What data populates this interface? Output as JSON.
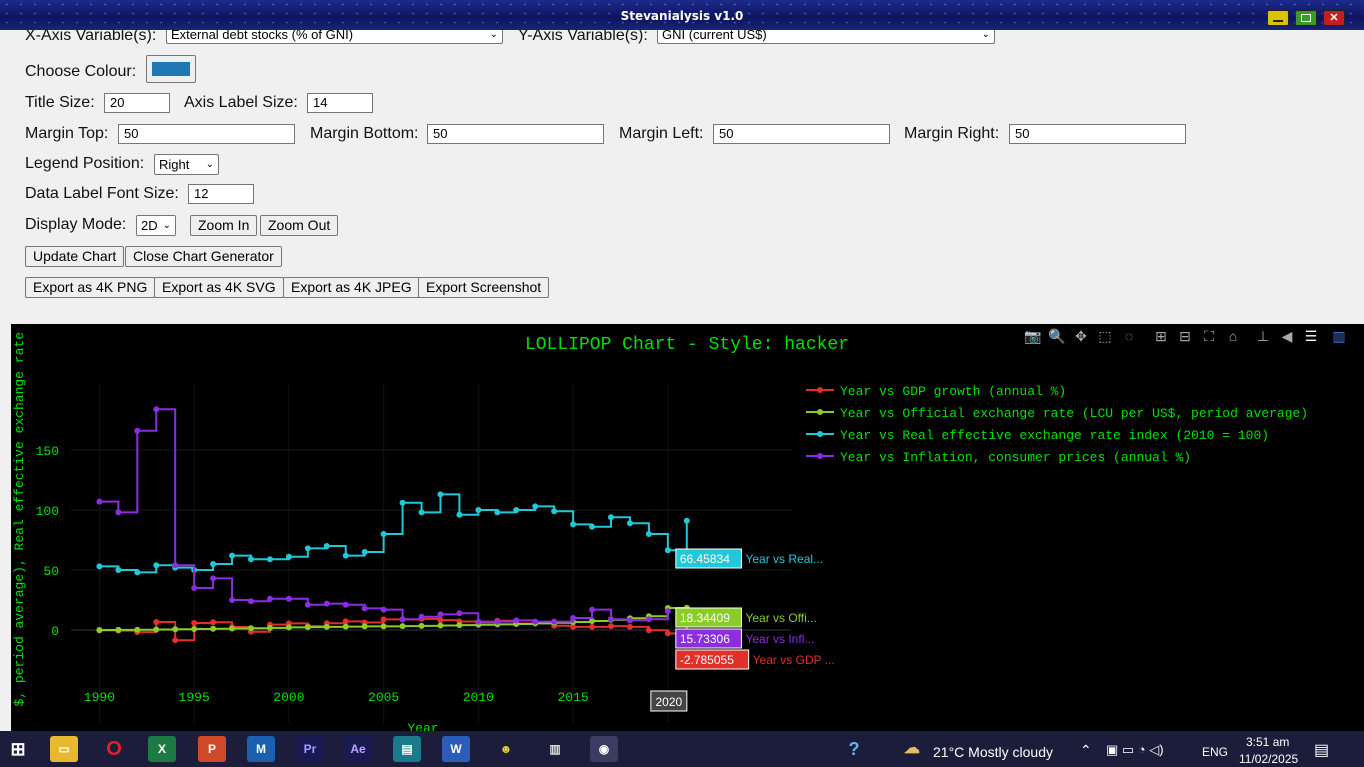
{
  "window": {
    "title": "Stevanialysis v1.0"
  },
  "form": {
    "x_axis_label": "X-Axis Variable(s):",
    "x_axis_value": "External debt stocks (% of GNI)",
    "y_axis_label": "Y-Axis Variable(s):",
    "y_axis_value": "GNI (current US$)",
    "colour_label": "Choose Colour:",
    "colour_value": "#1f77b4",
    "title_size_label": "Title Size:",
    "title_size_value": "20",
    "axis_label_size_label": "Axis Label Size:",
    "axis_label_size_value": "14",
    "margin_top_label": "Margin Top:",
    "margin_top_value": "50",
    "margin_bottom_label": "Margin Bottom:",
    "margin_bottom_value": "50",
    "margin_left_label": "Margin Left:",
    "margin_left_value": "50",
    "margin_right_label": "Margin Right:",
    "margin_right_value": "50",
    "legend_position_label": "Legend Position:",
    "legend_position_value": "Right",
    "data_label_font_label": "Data Label Font Size:",
    "data_label_font_value": "12",
    "display_mode_label": "Display Mode:",
    "display_mode_value": "2D",
    "zoom_in": "Zoom In",
    "zoom_out": "Zoom Out",
    "update_chart": "Update Chart",
    "close_generator": "Close Chart Generator",
    "export_png": "Export as 4K PNG",
    "export_svg": "Export as 4K SVG",
    "export_jpeg": "Export as 4K JPEG",
    "export_screenshot": "Export Screenshot"
  },
  "chart_data": {
    "type": "line",
    "line_shape": "step",
    "title": "LOLLIPOP Chart - Style: hacker",
    "xlabel": "Year",
    "ylabel": "$, period average), Real effective exchange rate",
    "xlim": [
      1988.5,
      2026.5
    ],
    "ylim": [
      -45,
      205
    ],
    "x_ticks": [
      1990,
      1995,
      2000,
      2005,
      2010,
      2015,
      2020
    ],
    "y_ticks": [
      0,
      50,
      100,
      150
    ],
    "grid": true,
    "legend_position": "top-right",
    "background": "#000000",
    "text_color": "#00e000",
    "series": [
      {
        "name": "Year vs GDP growth (annual %)",
        "color": "#e0302a",
        "x": [
          1990,
          1991,
          1992,
          1993,
          1994,
          1995,
          1996,
          1997,
          1998,
          1999,
          2000,
          2001,
          2002,
          2003,
          2004,
          2005,
          2006,
          2007,
          2008,
          2009,
          2010,
          2011,
          2012,
          2013,
          2014,
          2015,
          2016,
          2017,
          2018,
          2019,
          2020,
          2021
        ],
        "y": [
          -0.3,
          -0.5,
          -1.8,
          6.7,
          -8.5,
          5.8,
          6.5,
          2.5,
          -1.5,
          4.5,
          5.5,
          3.2,
          5.6,
          7.2,
          6.2,
          8.9,
          8.7,
          9.3,
          8.2,
          7.1,
          6.4,
          7.7,
          5.4,
          5.5,
          3.5,
          2.6,
          2.6,
          3.2,
          2.6,
          -0.2,
          -2.785055,
          5.2
        ],
        "hover_label": "-2.785055",
        "hover_name": "Year vs GDP ..."
      },
      {
        "name": "Year vs Official exchange rate (LCU per US$, period average)",
        "color": "#8acc2a",
        "x": [
          1990,
          1991,
          1992,
          1993,
          1994,
          1995,
          1996,
          1997,
          1998,
          1999,
          2000,
          2001,
          2002,
          2003,
          2004,
          2005,
          2006,
          2007,
          2008,
          2009,
          2010,
          2011,
          2012,
          2013,
          2014,
          2015,
          2016,
          2017,
          2018,
          2019,
          2020,
          2021
        ],
        "y": [
          0,
          0.1,
          0.2,
          0.4,
          0.6,
          0.8,
          1.0,
          1.2,
          1.5,
          1.8,
          2.2,
          2.4,
          2.6,
          2.8,
          3.0,
          3.0,
          3.2,
          3.4,
          3.7,
          4.1,
          4.4,
          4.7,
          5.0,
          5.5,
          6.0,
          6.7,
          7.5,
          8.5,
          9.8,
          11.5,
          18.34409,
          18.5
        ],
        "hover_label": "18.34409",
        "hover_name": "Year vs Offi..."
      },
      {
        "name": "Year vs Real effective exchange rate index (2010 = 100)",
        "color": "#22c8d8",
        "x": [
          1990,
          1991,
          1992,
          1993,
          1994,
          1995,
          1996,
          1997,
          1998,
          1999,
          2000,
          2001,
          2002,
          2003,
          2004,
          2005,
          2006,
          2007,
          2008,
          2009,
          2010,
          2011,
          2012,
          2013,
          2014,
          2015,
          2016,
          2017,
          2018,
          2019,
          2020,
          2021
        ],
        "y": [
          53,
          50,
          48,
          54,
          52,
          50,
          55,
          62,
          59,
          59,
          61,
          68,
          70,
          62,
          65,
          80,
          106,
          98,
          113,
          96,
          100,
          98,
          100,
          103,
          99,
          88,
          86,
          94,
          89,
          80,
          66.45834,
          91
        ],
        "hover_label": "66.45834",
        "hover_name": "Year vs Real..."
      },
      {
        "name": "Year vs Inflation, consumer prices (annual %)",
        "color": "#8a2ee0",
        "x": [
          1990,
          1991,
          1992,
          1993,
          1994,
          1995,
          1996,
          1997,
          1998,
          1999,
          2000,
          2001,
          2002,
          2003,
          2004,
          2005,
          2006,
          2007,
          2008,
          2009,
          2010,
          2011,
          2012,
          2013,
          2014,
          2015,
          2016,
          2017,
          2018,
          2019,
          2020
        ],
        "y": [
          107,
          98,
          166,
          184,
          54,
          35,
          43,
          25,
          24,
          26,
          26,
          21,
          22,
          21,
          18,
          17,
          9,
          11,
          13,
          14,
          7,
          7,
          8,
          7,
          7,
          10,
          17,
          9,
          8,
          9,
          15.73306
        ],
        "hover_label": "15.73306",
        "hover_name": "Year vs Infl..."
      }
    ],
    "hover_x_label": "2020"
  },
  "modebar_icons": [
    "camera-icon",
    "zoom-icon",
    "pan-icon",
    "box-select-icon",
    "lasso-icon",
    "zoom-in-icon",
    "zoom-out-icon",
    "autoscale-icon",
    "home-icon",
    "spike-icon",
    "hover-closest-icon",
    "hover-compare-icon",
    "plotly-logo-icon"
  ],
  "taskbar": {
    "weather": "21°C  Mostly cloudy",
    "language": "ENG",
    "time": "3:51 am",
    "date": "11/02/2025",
    "apps": [
      "file-explorer-icon",
      "opera-icon",
      "excel-icon",
      "powerpoint-icon",
      "app-m-icon",
      "premiere-icon",
      "after-effects-icon",
      "terminal-icon",
      "word-icon",
      "game-icon",
      "stats-icon",
      "python-icon"
    ]
  }
}
